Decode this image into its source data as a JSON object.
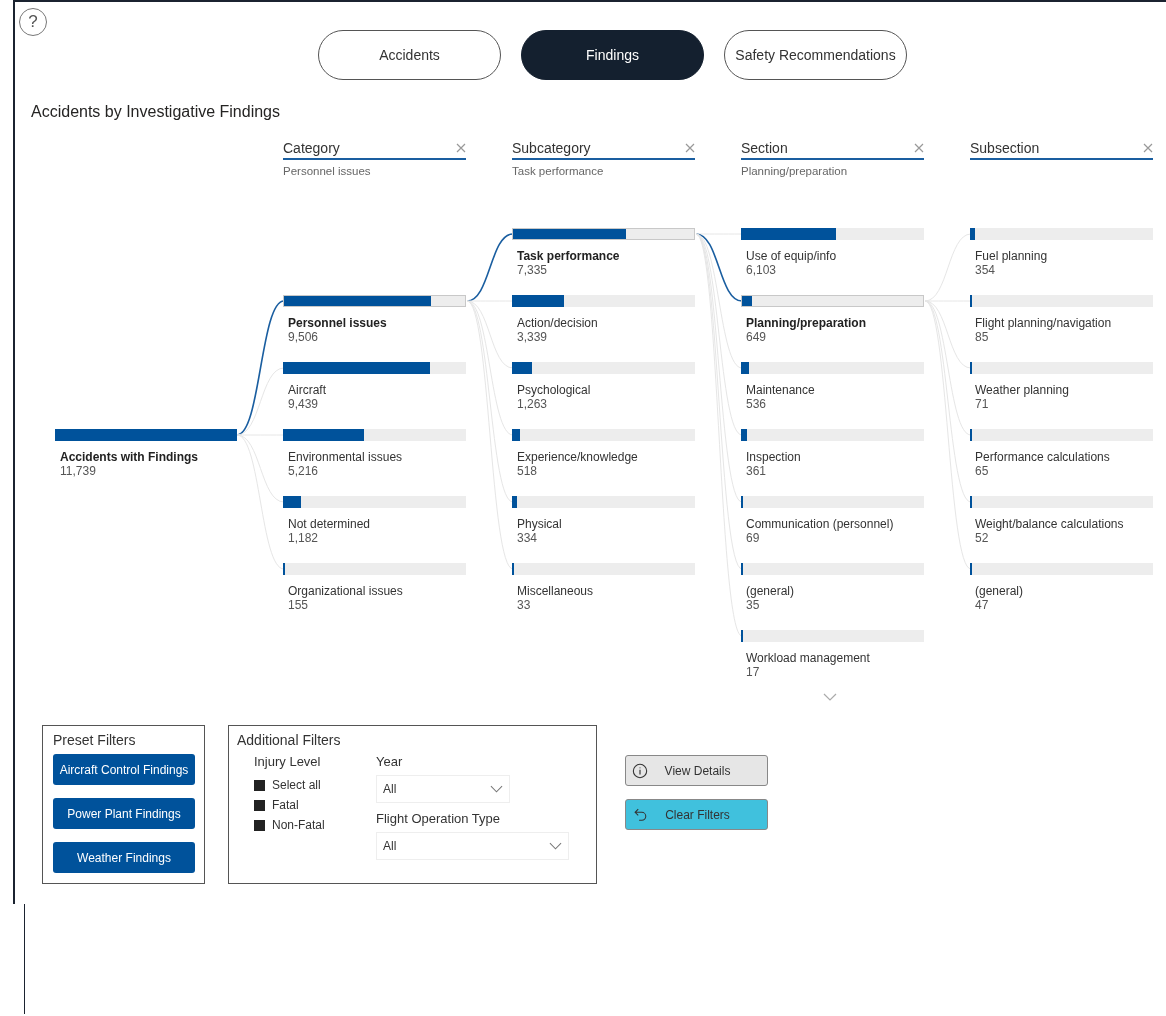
{
  "help_button": "?",
  "tabs": [
    {
      "label": "Accidents",
      "selected": false
    },
    {
      "label": "Findings",
      "selected": true
    },
    {
      "label": "Safety Recommendations",
      "selected": false
    }
  ],
  "visual_title": "Accidents by Investigative Findings",
  "tree": {
    "root": {
      "label": "Accidents with Findings",
      "value": "11,739"
    },
    "levels": [
      {
        "header": "Category",
        "selection": "Personnel issues",
        "nodes": [
          {
            "label": "Personnel issues",
            "value": "9,506",
            "level": 0.81,
            "selected": true
          },
          {
            "label": "Aircraft",
            "value": "9,439",
            "level": 0.804,
            "selected": false
          },
          {
            "label": "Environmental issues",
            "value": "5,216",
            "level": 0.444,
            "selected": false
          },
          {
            "label": "Not determined",
            "value": "1,182",
            "level": 0.101,
            "selected": false
          },
          {
            "label": "Organizational issues",
            "value": "155",
            "level": 0.013,
            "selected": false
          }
        ]
      },
      {
        "header": "Subcategory",
        "selection": "Task performance",
        "nodes": [
          {
            "label": "Task performance",
            "value": "7,335",
            "level": 0.625,
            "selected": true
          },
          {
            "label": "Action/decision",
            "value": "3,339",
            "level": 0.284,
            "selected": false
          },
          {
            "label": "Psychological",
            "value": "1,263",
            "level": 0.108,
            "selected": false
          },
          {
            "label": "Experience/knowledge",
            "value": "518",
            "level": 0.044,
            "selected": false
          },
          {
            "label": "Physical",
            "value": "334",
            "level": 0.028,
            "selected": false
          },
          {
            "label": "Miscellaneous",
            "value": "33",
            "level": 0.003,
            "selected": false
          }
        ]
      },
      {
        "header": "Section",
        "selection": "Planning/preparation",
        "nodes": [
          {
            "label": "Use of equip/info",
            "value": "6,103",
            "level": 0.52,
            "selected": false
          },
          {
            "label": "Planning/preparation",
            "value": "649",
            "level": 0.055,
            "selected": true
          },
          {
            "label": "Maintenance",
            "value": "536",
            "level": 0.046,
            "selected": false
          },
          {
            "label": "Inspection",
            "value": "361",
            "level": 0.031,
            "selected": false
          },
          {
            "label": "Communication (personnel)",
            "value": "69",
            "level": 0.006,
            "selected": false
          },
          {
            "label": "(general)",
            "value": "35",
            "level": 0.003,
            "selected": false
          },
          {
            "label": "Workload management",
            "value": "17",
            "level": 0.0015,
            "selected": false
          }
        ]
      },
      {
        "header": "Subsection",
        "nodes": [
          {
            "label": "Fuel planning",
            "value": "354",
            "level": 0.03,
            "selected": false
          },
          {
            "label": "Flight planning/navigation",
            "value": "85",
            "level": 0.007,
            "selected": false
          },
          {
            "label": "Weather planning",
            "value": "71",
            "level": 0.006,
            "selected": false
          },
          {
            "label": "Performance calculations",
            "value": "65",
            "level": 0.0055,
            "selected": false
          },
          {
            "label": "Weight/balance calculations",
            "value": "52",
            "level": 0.0044,
            "selected": false
          },
          {
            "label": "(general)",
            "value": "47",
            "level": 0.004,
            "selected": false
          }
        ]
      }
    ]
  },
  "preset_filters": {
    "title": "Preset Filters",
    "buttons": [
      "Aircraft Control Findings",
      "Power Plant Findings",
      "Weather Findings"
    ]
  },
  "additional_filters": {
    "title": "Additional Filters",
    "injury_level": {
      "label": "Injury Level",
      "options": [
        {
          "label": "Select all",
          "checked": true
        },
        {
          "label": "Fatal",
          "checked": true
        },
        {
          "label": "Non-Fatal",
          "checked": true
        }
      ]
    },
    "year": {
      "label": "Year",
      "value": "All"
    },
    "flight_operation_type": {
      "label": "Flight Operation Type",
      "value": "All"
    }
  },
  "actions": [
    {
      "label": "View Details",
      "kind": "info"
    },
    {
      "label": "Clear Filters",
      "kind": "undo"
    }
  ]
}
